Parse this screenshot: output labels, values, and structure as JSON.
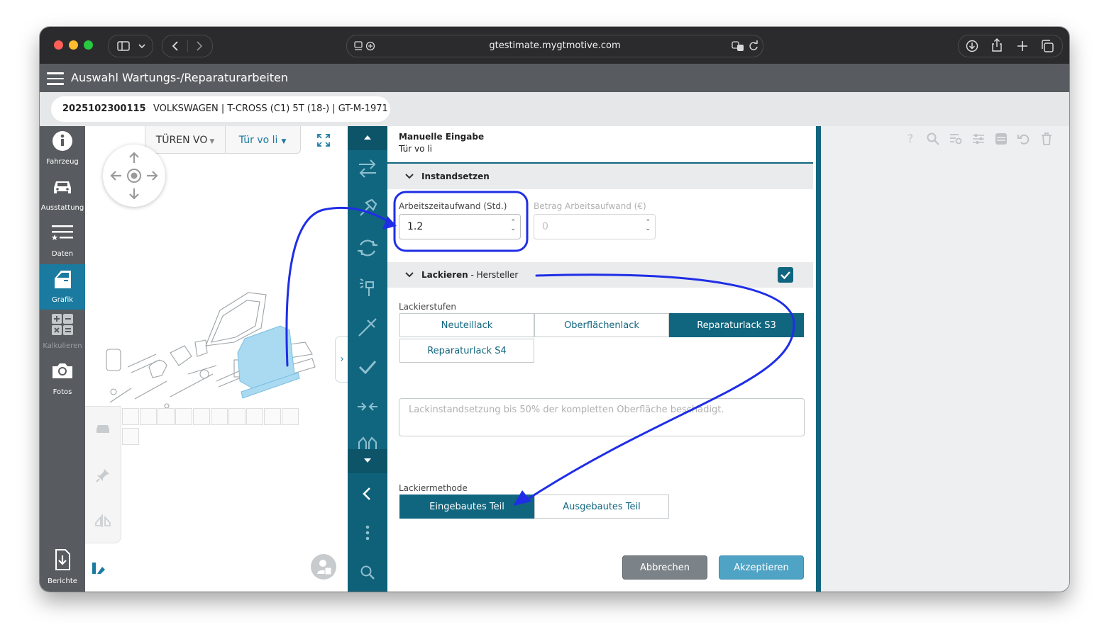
{
  "browser": {
    "url": "gtestimate.mygtmotive.com"
  },
  "app": {
    "title": "Auswahl Wartungs-/Reparaturarbeiten",
    "vehicle_id": "2025102300115",
    "vehicle_desc": "VOLKSWAGEN | T-CROSS (C1) 5T (18-) | GT-M-1971"
  },
  "nav": {
    "items": [
      {
        "label": "Fahrzeug",
        "icon": "info-icon"
      },
      {
        "label": "Ausstattung",
        "icon": "car-icon"
      },
      {
        "label": "Daten",
        "icon": "list-star-icon"
      },
      {
        "label": "Grafik",
        "icon": "car-door-icon",
        "active": true
      },
      {
        "label": "Kalkulieren",
        "icon": "calculator-icon",
        "disabled": true
      },
      {
        "label": "Fotos",
        "icon": "camera-icon"
      },
      {
        "label": "Berichte",
        "icon": "download-document-icon"
      }
    ]
  },
  "graphic": {
    "group_dropdown": "TÜREN VO",
    "part_dropdown": "Tür vo li"
  },
  "form": {
    "title": "Manuelle Eingabe",
    "subtitle": "Tür vo li",
    "repair": {
      "section_title": "Instandsetzen",
      "labor_time_label": "Arbeitszeitaufwand (Std.)",
      "labor_time_value": "1.2",
      "labor_amount_label": "Betrag Arbeitsaufwand (€)",
      "labor_amount_value": "0"
    },
    "paint": {
      "section_title": "Lackieren",
      "section_suffix": " - Hersteller",
      "checked": true,
      "levels_label": "Lackierstufen",
      "levels": [
        "Neuteillack",
        "Oberflächenlack",
        "Reparaturlack S3",
        "Reparaturlack S4"
      ],
      "selected_level": "Reparaturlack S3",
      "note_placeholder": "Lackinstandsetzung bis 50% der kompletten Oberfläche beschädigt.",
      "method_label": "Lackiermethode",
      "methods": [
        "Eingebautes Teil",
        "Ausgebautes Teil"
      ],
      "selected_method": "Eingebautes Teil"
    },
    "buttons": {
      "cancel": "Abbrechen",
      "accept": "Akzeptieren"
    }
  },
  "colors": {
    "accent": "#11667f",
    "nav_bg": "#585c60",
    "active_nav": "#1a7aa0",
    "annotation": "#1f2ee6"
  }
}
